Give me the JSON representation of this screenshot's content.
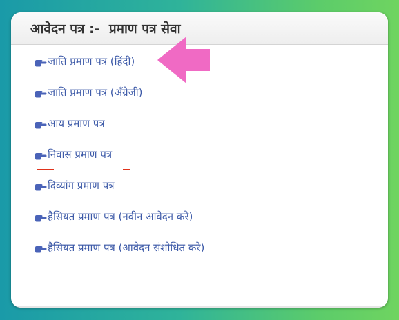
{
  "panel": {
    "title": "आवेदन पत्र :-  प्रमाण पत्र सेवा",
    "items": [
      {
        "label": "जाति प्रमाण पत्र (हिंदी)"
      },
      {
        "label": "जाति प्रमाण पत्र (अँग्रेजी)"
      },
      {
        "label": "आय प्रमाण पत्र"
      },
      {
        "label": "निवास प्रमाण पत्र"
      },
      {
        "label": "दिव्यांग प्रमाण पत्र"
      },
      {
        "label": "हैसियत प्रमाण पत्र (नवीन आवेदन करे)"
      },
      {
        "label": "हैसियत प्रमाण पत्र (आवेदन संशोधित करे)"
      }
    ]
  },
  "icons": {
    "item_icon": "pointing-hand-icon",
    "annotation": "pink-arrow-icon"
  },
  "colors": {
    "link": "#3d5aa8",
    "hand": "#4a63b8",
    "arrow": "#f06ac4",
    "header_text": "#333333"
  }
}
